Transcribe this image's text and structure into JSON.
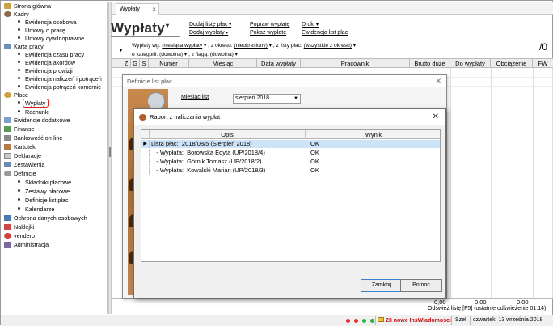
{
  "nav": {
    "items": [
      {
        "label": "Strona główna",
        "level": 0
      },
      {
        "label": "Kadry",
        "level": 0
      },
      {
        "label": "Ewidencja osobowa",
        "level": 1
      },
      {
        "label": "Umowy o pracę",
        "level": 1
      },
      {
        "label": "Umowy cywilnoprawne",
        "level": 1
      },
      {
        "label": "Karta pracy",
        "level": 0
      },
      {
        "label": "Ewidencja czasu pracy",
        "level": 1
      },
      {
        "label": "Ewidencja akordów",
        "level": 1
      },
      {
        "label": "Ewidencja prowizji",
        "level": 1
      },
      {
        "label": "Ewidencja naliczeń i potrąceń",
        "level": 1
      },
      {
        "label": "Ewidencja potrąceń komornic",
        "level": 1
      },
      {
        "label": "Płace",
        "level": 0
      },
      {
        "label": "Wypłaty",
        "level": 1
      },
      {
        "label": "Rachunki",
        "level": 1
      },
      {
        "label": "Ewidencje dodatkowe",
        "level": 0
      },
      {
        "label": "Finanse",
        "level": 0
      },
      {
        "label": "Bankowość on-line",
        "level": 0
      },
      {
        "label": "Kartoteki",
        "level": 0
      },
      {
        "label": "Deklaracje",
        "level": 0
      },
      {
        "label": "Zestawienia",
        "level": 0
      },
      {
        "label": "Definicje",
        "level": 0
      },
      {
        "label": "Składniki płacowe",
        "level": 1
      },
      {
        "label": "Zestawy płacowe",
        "level": 1
      },
      {
        "label": "Definicje list płac",
        "level": 1
      },
      {
        "label": "Kalendarze",
        "level": 1
      },
      {
        "label": "Ochrona danych osobowych",
        "level": 0
      },
      {
        "label": "Naklejki",
        "level": 0
      },
      {
        "label": "vendero",
        "level": 0
      },
      {
        "label": "Administracja",
        "level": 0
      }
    ]
  },
  "tab": {
    "label": "Wypłaty",
    "close": "×"
  },
  "header": {
    "title": "Wypłaty",
    "links": {
      "add_list": "Dodaj listę płac",
      "add_payout": "Dodaj wypłaty",
      "fix_payout": "Popraw wypłatę",
      "show_payout": "Pokaż wypłatę",
      "prints": "Druki",
      "records": "Ewidencja list płac"
    }
  },
  "filters": {
    "line1_prefix": "Wypłaty wg:",
    "by_value": "miesiąca wypłaty",
    "period_label": ", z okresu:",
    "period_value": "(nieokreślony)",
    "list_label": ", z listy płac:",
    "list_value": "(wszystkie z okresu)",
    "line2_prefix": "o kategorii:",
    "category_value": "(dowolna)",
    "flag_label": ", z flagą:",
    "flag_value": "(dowolna)",
    "page": "/0"
  },
  "grid": {
    "columns": [
      "Z",
      "G",
      "S",
      "Numer",
      "Miesiąc",
      "Data wypłaty",
      "Pracownik",
      "Brutto duże",
      "Do wypłaty",
      "Obciążenie",
      "FW"
    ],
    "totals": {
      "do_wyplaty": "0,00",
      "obciazenie": "0,00",
      "brutto": "0,00"
    },
    "refresh_link": "Odśwież listę [F5]",
    "refresh_info": "(ostatnie odświeżenie 01:14)"
  },
  "status": {
    "notifications": "23 nowe InsWiadomości",
    "user": "Szef",
    "date": "czwartek, 13 września 2018"
  },
  "dialog_def": {
    "title": "Definicje list płac",
    "close": "✕",
    "month_label": "Miesiąc list",
    "month_value": "sierpień 2018"
  },
  "dialog_report": {
    "title": "Raport z naliczania wypłat",
    "close": "✕",
    "col_opis": "Opis",
    "col_wynik": "Wynik",
    "rows": [
      {
        "opis": "Lista płac:  2018/08/5 (Sierpień 2018)",
        "wynik": "OK"
      },
      {
        "opis": "   - Wypłata:  Borowska Edyta (UP/2018/4)",
        "wynik": "OK"
      },
      {
        "opis": "   - Wypłata:  Górnik Tomasz (UP/2018/2)",
        "wynik": "OK"
      },
      {
        "opis": "   - Wypłata:  Kowalski Marian (UP/2018/3)",
        "wynik": "OK"
      }
    ],
    "ok_button": "Zamknij",
    "help_button": "Pomoc"
  }
}
